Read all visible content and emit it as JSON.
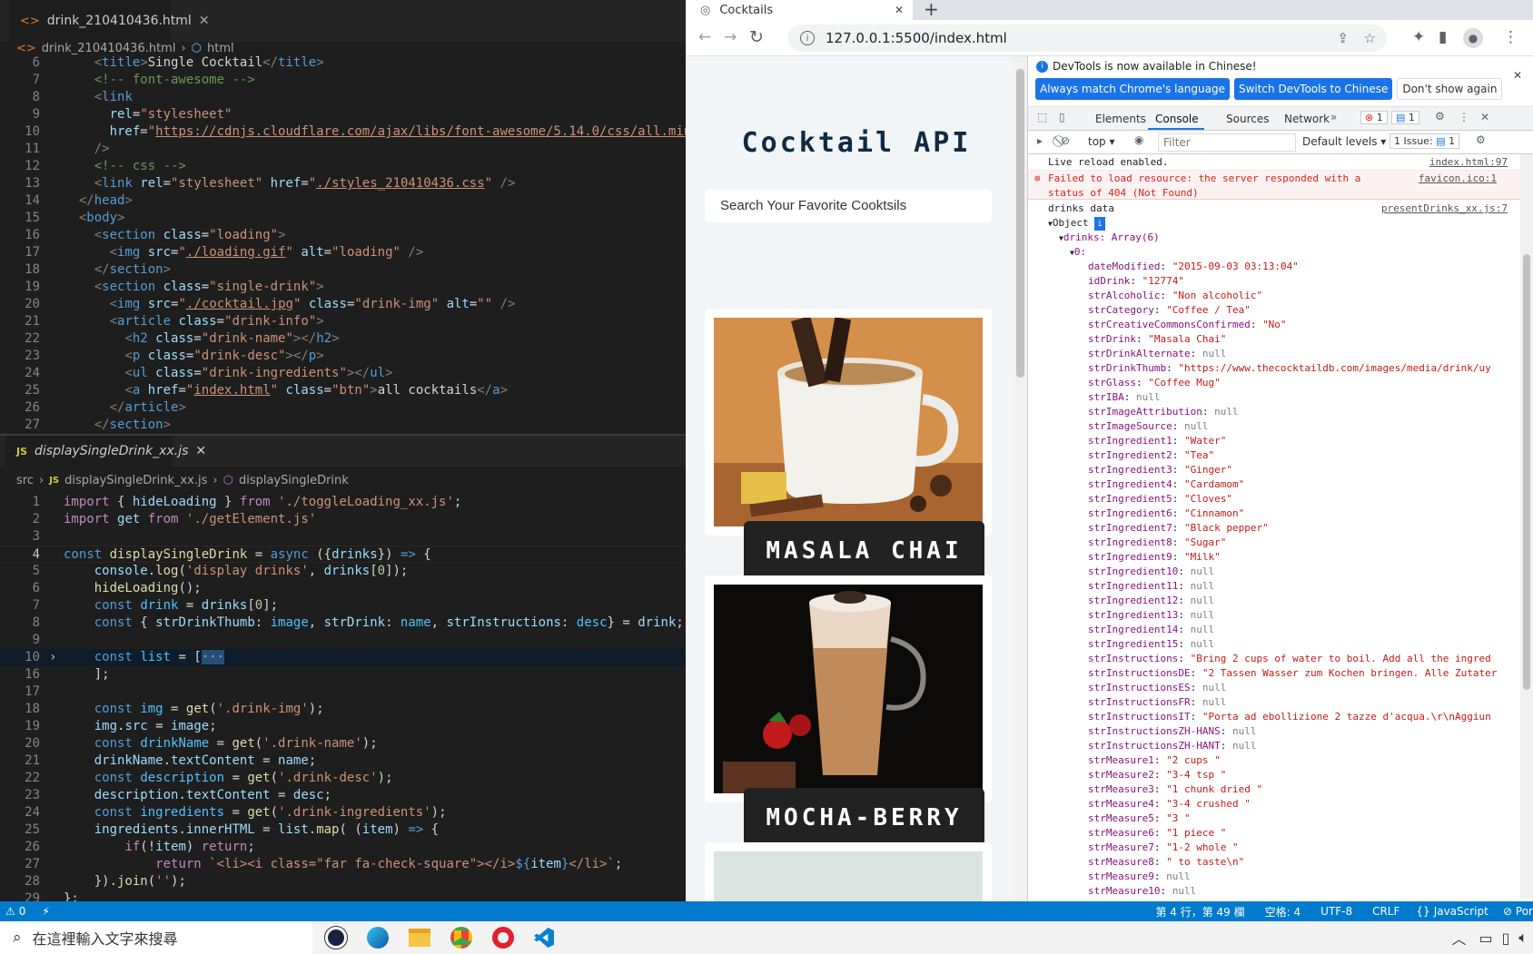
{
  "vscode": {
    "top_tab": {
      "label": "drink_210410436.html"
    },
    "top_breadcrumb": {
      "file": "drink_210410436.html",
      "symbol": "html"
    },
    "bottom_tab": {
      "label": "displaySingleDrink_xx.js"
    },
    "bottom_breadcrumb": {
      "folder": "src",
      "file": "displaySingleDrink_xx.js",
      "symbol": "displaySingleDrink"
    },
    "html_line_numbers": [
      "6",
      "7",
      "8",
      "9",
      "10",
      "11",
      "12",
      "13",
      "14",
      "15",
      "16",
      "17",
      "18",
      "19",
      "20",
      "21",
      "22",
      "23",
      "24",
      "25",
      "26",
      "27"
    ],
    "js_line_numbers": [
      "1",
      "2",
      "3",
      "4",
      "5",
      "6",
      "7",
      "8",
      "9",
      "10",
      "16",
      "17",
      "18",
      "19",
      "20",
      "21",
      "22",
      "23",
      "24",
      "25",
      "26",
      "27",
      "28",
      "29"
    ]
  },
  "statusbar": {
    "problems": "0",
    "position": "第 4 行，第 49 欄",
    "spaces": "空格: 4",
    "encoding": "UTF-8",
    "eol": "CRLF",
    "language": "JavaScript",
    "port": "Por"
  },
  "taskbar": {
    "search_placeholder": "在這裡輸入文字來搜尋"
  },
  "chrome": {
    "tab_title": "Cocktails",
    "url": "127.0.0.1:5500/index.html"
  },
  "page": {
    "title": "Cocktail API",
    "search_placeholder": "Search Your Favorite Cooktsils",
    "drinks": [
      {
        "name": "MASALA CHAI"
      },
      {
        "name": "MOCHA-BERRY"
      }
    ]
  },
  "devtools": {
    "banner_text": "DevTools is now available in Chinese!",
    "btn_match": "Always match Chrome's language",
    "btn_switch": "Switch DevTools to Chinese",
    "btn_dismiss": "Don't show again",
    "tabs": [
      "Elements",
      "Console",
      "Sources",
      "Network"
    ],
    "error_count": "1",
    "message_count": "1",
    "context": "top",
    "filter_placeholder": "Filter",
    "levels": "Default levels",
    "issues": "1 Issue:",
    "issues_count": "1",
    "log1": {
      "text": "Live reload enabled.",
      "src": "index.html:97"
    },
    "log2": {
      "text": "Failed to load resource: the server responded with a status of 404 (Not Found)",
      "src": "favicon.ico:1"
    },
    "log3": {
      "text": "drinks data",
      "src": "presentDrinks_xx.js:7"
    },
    "object_label": "Object",
    "drinks_label": "drinks: Array(6)",
    "index_label": "0:",
    "props": [
      [
        "dateModified",
        "\"2015-09-03 03:13:04\""
      ],
      [
        "idDrink",
        "\"12774\""
      ],
      [
        "strAlcoholic",
        "\"Non alcoholic\""
      ],
      [
        "strCategory",
        "\"Coffee / Tea\""
      ],
      [
        "strCreativeCommonsConfirmed",
        "\"No\""
      ],
      [
        "strDrink",
        "\"Masala Chai\""
      ],
      [
        "strDrinkAlternate",
        "null"
      ],
      [
        "strDrinkThumb",
        "\"https://www.thecocktaildb.com/images/media/drink/uy"
      ],
      [
        "strGlass",
        "\"Coffee Mug\""
      ],
      [
        "strIBA",
        "null"
      ],
      [
        "strImageAttribution",
        "null"
      ],
      [
        "strImageSource",
        "null"
      ],
      [
        "strIngredient1",
        "\"Water\""
      ],
      [
        "strIngredient2",
        "\"Tea\""
      ],
      [
        "strIngredient3",
        "\"Ginger\""
      ],
      [
        "strIngredient4",
        "\"Cardamom\""
      ],
      [
        "strIngredient5",
        "\"Cloves\""
      ],
      [
        "strIngredient6",
        "\"Cinnamon\""
      ],
      [
        "strIngredient7",
        "\"Black pepper\""
      ],
      [
        "strIngredient8",
        "\"Sugar\""
      ],
      [
        "strIngredient9",
        "\"Milk\""
      ],
      [
        "strIngredient10",
        "null"
      ],
      [
        "strIngredient11",
        "null"
      ],
      [
        "strIngredient12",
        "null"
      ],
      [
        "strIngredient13",
        "null"
      ],
      [
        "strIngredient14",
        "null"
      ],
      [
        "strIngredient15",
        "null"
      ],
      [
        "strInstructions",
        "\"Bring 2 cups of water to boil. Add all the ingred"
      ],
      [
        "strInstructionsDE",
        "\"2 Tassen Wasser zum Kochen bringen. Alle Zutater"
      ],
      [
        "strInstructionsES",
        "null"
      ],
      [
        "strInstructionsFR",
        "null"
      ],
      [
        "strInstructionsIT",
        "\"Porta ad ebollizione 2 tazze d'acqua.\\r\\nAggiun"
      ],
      [
        "strInstructionsZH-HANS",
        "null"
      ],
      [
        "strInstructionsZH-HANT",
        "null"
      ],
      [
        "strMeasure1",
        "\"2 cups \""
      ],
      [
        "strMeasure2",
        "\"3-4 tsp \""
      ],
      [
        "strMeasure3",
        "\"1 chunk dried \""
      ],
      [
        "strMeasure4",
        "\"3-4 crushed \""
      ],
      [
        "strMeasure5",
        "\"3 \""
      ],
      [
        "strMeasure6",
        "\"1 piece \""
      ],
      [
        "strMeasure7",
        "\"1-2 whole \""
      ],
      [
        "strMeasure8",
        "\" to taste\\n\""
      ],
      [
        "strMeasure9",
        "null"
      ],
      [
        "strMeasure10",
        "null"
      ]
    ]
  },
  "colors": {
    "accent": "#007acc",
    "chrome_blue": "#1a73e8",
    "error": "#c41a16"
  }
}
